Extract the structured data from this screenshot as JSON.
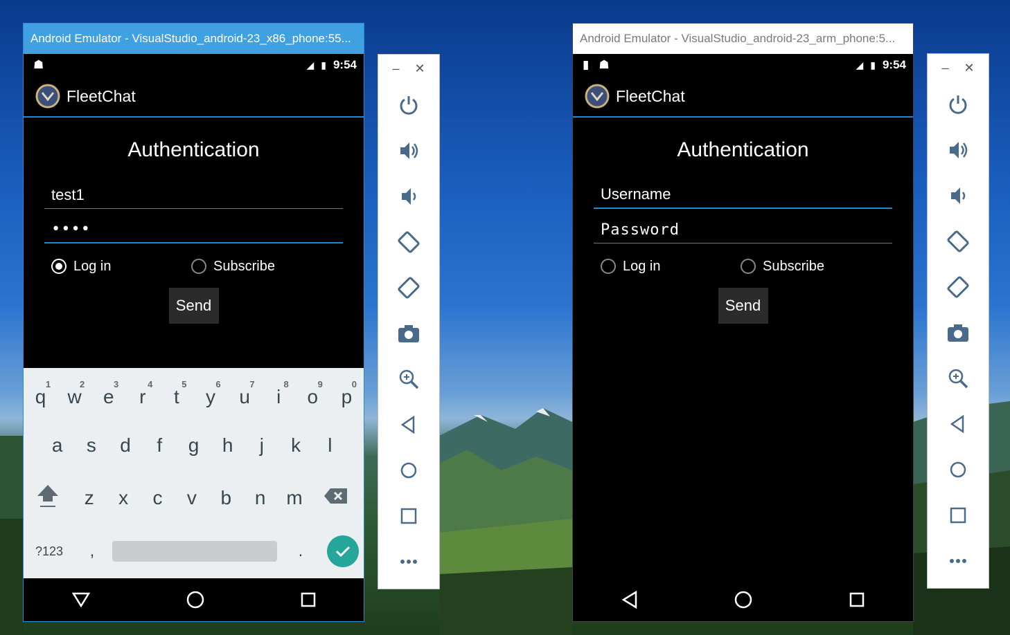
{
  "left_window": {
    "title": "Android Emulator - VisualStudio_android-23_x86_phone:55...",
    "status_time": "9:54",
    "app_title": "FleetChat",
    "heading": "Authentication",
    "username_value": "test1",
    "password_value": "••••",
    "radio_login": "Log in",
    "radio_subscribe": "Subscribe",
    "send_label": "Send",
    "keyboard": {
      "row1": [
        [
          "q",
          "1"
        ],
        [
          "w",
          "2"
        ],
        [
          "e",
          "3"
        ],
        [
          "r",
          "4"
        ],
        [
          "t",
          "5"
        ],
        [
          "y",
          "6"
        ],
        [
          "u",
          "7"
        ],
        [
          "i",
          "8"
        ],
        [
          "o",
          "9"
        ],
        [
          "p",
          "0"
        ]
      ],
      "row2": [
        "a",
        "s",
        "d",
        "f",
        "g",
        "h",
        "j",
        "k",
        "l"
      ],
      "row3": [
        "z",
        "x",
        "c",
        "v",
        "b",
        "n",
        "m"
      ],
      "symbols": "?123",
      "comma": ",",
      "period": "."
    }
  },
  "right_window": {
    "title": "Android Emulator - VisualStudio_android-23_arm_phone:5...",
    "status_time": "9:54",
    "app_title": "FleetChat",
    "heading": "Authentication",
    "username_placeholder": "Username",
    "password_placeholder": "Password",
    "radio_login": "Log in",
    "radio_subscribe": "Subscribe",
    "send_label": "Send"
  },
  "toolbar": {
    "minimize": "–",
    "close": "✕",
    "buttons": [
      "power-icon",
      "volume-up-icon",
      "volume-down-icon",
      "rotate-left-icon",
      "rotate-right-icon",
      "camera-icon",
      "zoom-icon",
      "back-icon",
      "home-icon",
      "overview-icon",
      "more-icon"
    ]
  },
  "colors": {
    "accent": "#1e8ad6",
    "title_active": "#3fa0e2",
    "keyboard_bg": "#eceff1",
    "check": "#26a69a"
  }
}
